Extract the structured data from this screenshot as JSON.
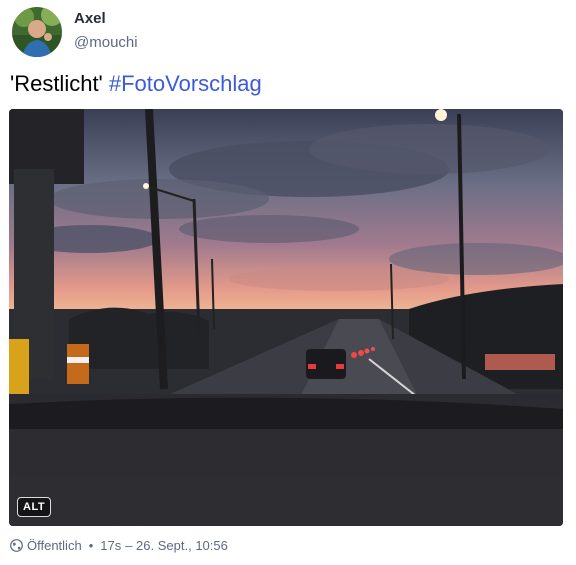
{
  "author": {
    "display_name": "Axel",
    "handle": "@mouchi"
  },
  "post": {
    "text_prefix": "'Restlicht' ",
    "hashtag": "#FotoVorschlag",
    "media_alt_badge": "ALT"
  },
  "meta": {
    "visibility": "Öffentlich",
    "separator": "•",
    "relative_time": "17s",
    "timestamp": "– 26. Sept., 10:56"
  },
  "icons": {
    "visibility_icon": "globe-icon"
  },
  "colors": {
    "hashtag": "#3b5bdb",
    "meta_text": "#606984"
  }
}
